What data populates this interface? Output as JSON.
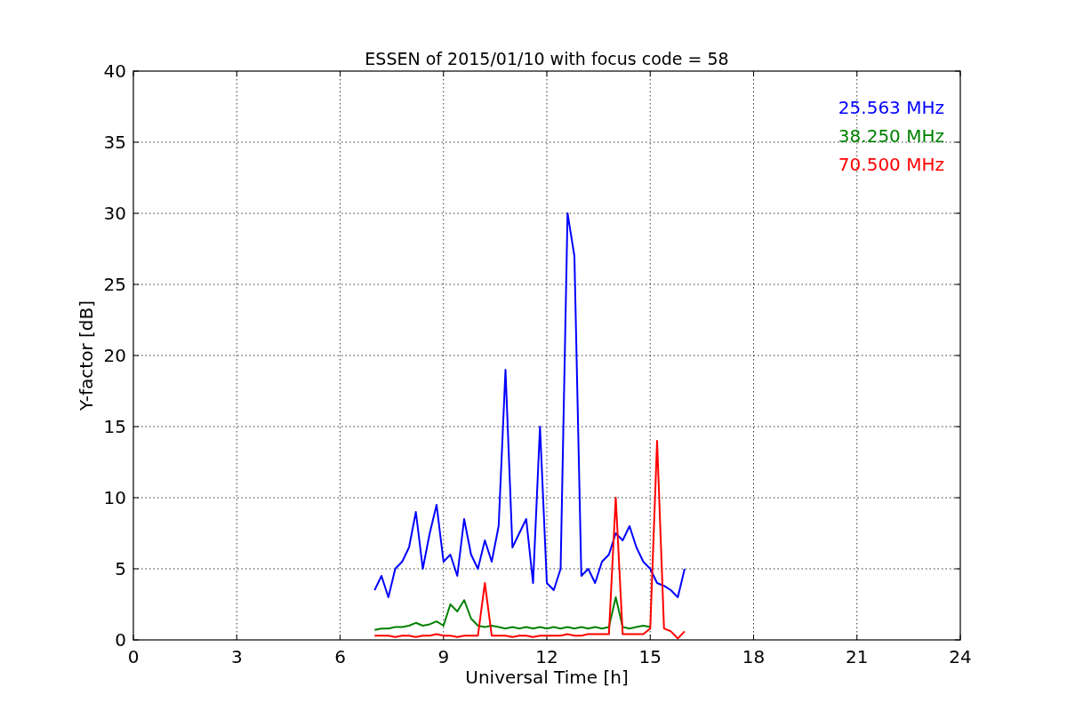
{
  "figure": {
    "chart_data": {
      "type": "line",
      "title": "ESSEN of 2015/01/10 with focus code = 58",
      "xlabel": "Universal Time [h]",
      "ylabel": "Y-factor [dB]",
      "x": [
        7.0,
        7.2,
        7.4,
        7.6,
        7.8,
        8.0,
        8.2,
        8.4,
        8.6,
        8.8,
        9.0,
        9.2,
        9.4,
        9.6,
        9.8,
        10.0,
        10.2,
        10.4,
        10.6,
        10.8,
        11.0,
        11.2,
        11.4,
        11.6,
        11.8,
        12.0,
        12.2,
        12.4,
        12.6,
        12.8,
        13.0,
        13.2,
        13.4,
        13.6,
        13.8,
        14.0,
        14.2,
        14.4,
        14.6,
        14.8,
        15.0,
        15.2,
        15.4,
        15.6,
        15.8,
        16.0
      ],
      "series": [
        {
          "name": "25.563 MHz",
          "color": "#0000ff",
          "values": [
            3.5,
            4.5,
            3.0,
            5.0,
            5.5,
            6.5,
            9.0,
            5.0,
            7.5,
            9.5,
            5.5,
            6.0,
            4.5,
            8.5,
            6.0,
            5.0,
            7.0,
            5.5,
            8.0,
            19.0,
            6.5,
            7.5,
            8.5,
            4.0,
            15.0,
            4.0,
            3.5,
            5.0,
            30.0,
            27.0,
            4.5,
            5.0,
            4.0,
            5.5,
            6.0,
            7.5,
            7.0,
            8.0,
            6.5,
            5.5,
            5.0,
            4.0,
            3.8,
            3.5,
            3.0,
            5.0
          ]
        },
        {
          "name": "38.250 MHz",
          "color": "#008000",
          "values": [
            0.7,
            0.8,
            0.8,
            0.9,
            0.9,
            1.0,
            1.2,
            1.0,
            1.1,
            1.3,
            1.0,
            2.5,
            2.0,
            2.8,
            1.5,
            1.0,
            0.9,
            1.0,
            0.9,
            0.8,
            0.9,
            0.8,
            0.9,
            0.8,
            0.9,
            0.8,
            0.9,
            0.8,
            0.9,
            0.8,
            0.9,
            0.8,
            0.9,
            0.8,
            0.9,
            3.0,
            0.9,
            0.8,
            0.9,
            1.0,
            0.9,
            null,
            null,
            null,
            null,
            null
          ]
        },
        {
          "name": "70.500 MHz",
          "color": "#ff0000",
          "values": [
            0.3,
            0.3,
            0.3,
            0.2,
            0.3,
            0.3,
            0.2,
            0.3,
            0.3,
            0.4,
            0.3,
            0.3,
            0.2,
            0.3,
            0.3,
            0.3,
            4.0,
            0.3,
            0.3,
            0.3,
            0.2,
            0.3,
            0.3,
            0.2,
            0.3,
            0.3,
            0.3,
            0.3,
            0.4,
            0.3,
            0.3,
            0.4,
            0.4,
            0.4,
            0.4,
            10.0,
            0.4,
            0.4,
            0.4,
            0.4,
            0.8,
            14.0,
            0.8,
            0.6,
            0.1,
            0.6
          ]
        }
      ],
      "xlim": [
        0,
        24
      ],
      "ylim": [
        0,
        40
      ],
      "xticks": [
        0,
        3,
        6,
        9,
        12,
        15,
        18,
        21,
        24
      ],
      "yticks": [
        0,
        5,
        10,
        15,
        20,
        25,
        30,
        35,
        40
      ],
      "grid": true
    }
  }
}
